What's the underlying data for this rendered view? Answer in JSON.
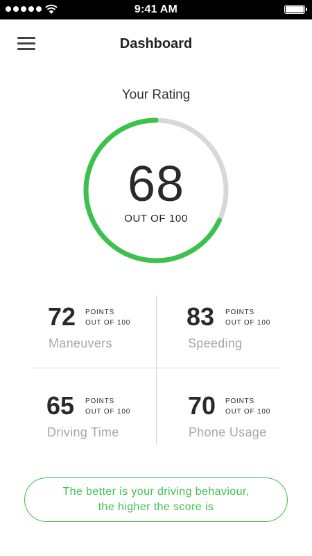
{
  "status_bar": {
    "time": "9:41 AM",
    "signal_icon": "signal-dots-icon",
    "wifi_icon": "wifi-icon",
    "battery_icon": "battery-icon",
    "battery_level": 1.0
  },
  "header": {
    "menu_icon": "hamburger-menu-icon",
    "title": "Dashboard"
  },
  "rating": {
    "label": "Your Rating",
    "value": "68",
    "max_label": "OUT OF 100",
    "fraction": 0.68
  },
  "metrics": [
    {
      "value": "72",
      "unit_line1": "POINTS",
      "unit_line2": "OUT OF 100",
      "name": "Maneuvers"
    },
    {
      "value": "83",
      "unit_line1": "POINTS",
      "unit_line2": "OUT OF 100",
      "name": "Speeding"
    },
    {
      "value": "65",
      "unit_line1": "POINTS",
      "unit_line2": "OUT OF 100",
      "name": "Driving Time"
    },
    {
      "value": "70",
      "unit_line1": "POINTS",
      "unit_line2": "OUT OF 100",
      "name": "Phone Usage"
    }
  ],
  "info": {
    "line1": "The better is your driving behaviour,",
    "line2": "the higher the score is"
  },
  "colors": {
    "accent_green": "#3cc24c",
    "gauge_track": "#d6d8dd",
    "metric_label": "#a7a7a7",
    "text_dark": "#2a2a2a"
  }
}
